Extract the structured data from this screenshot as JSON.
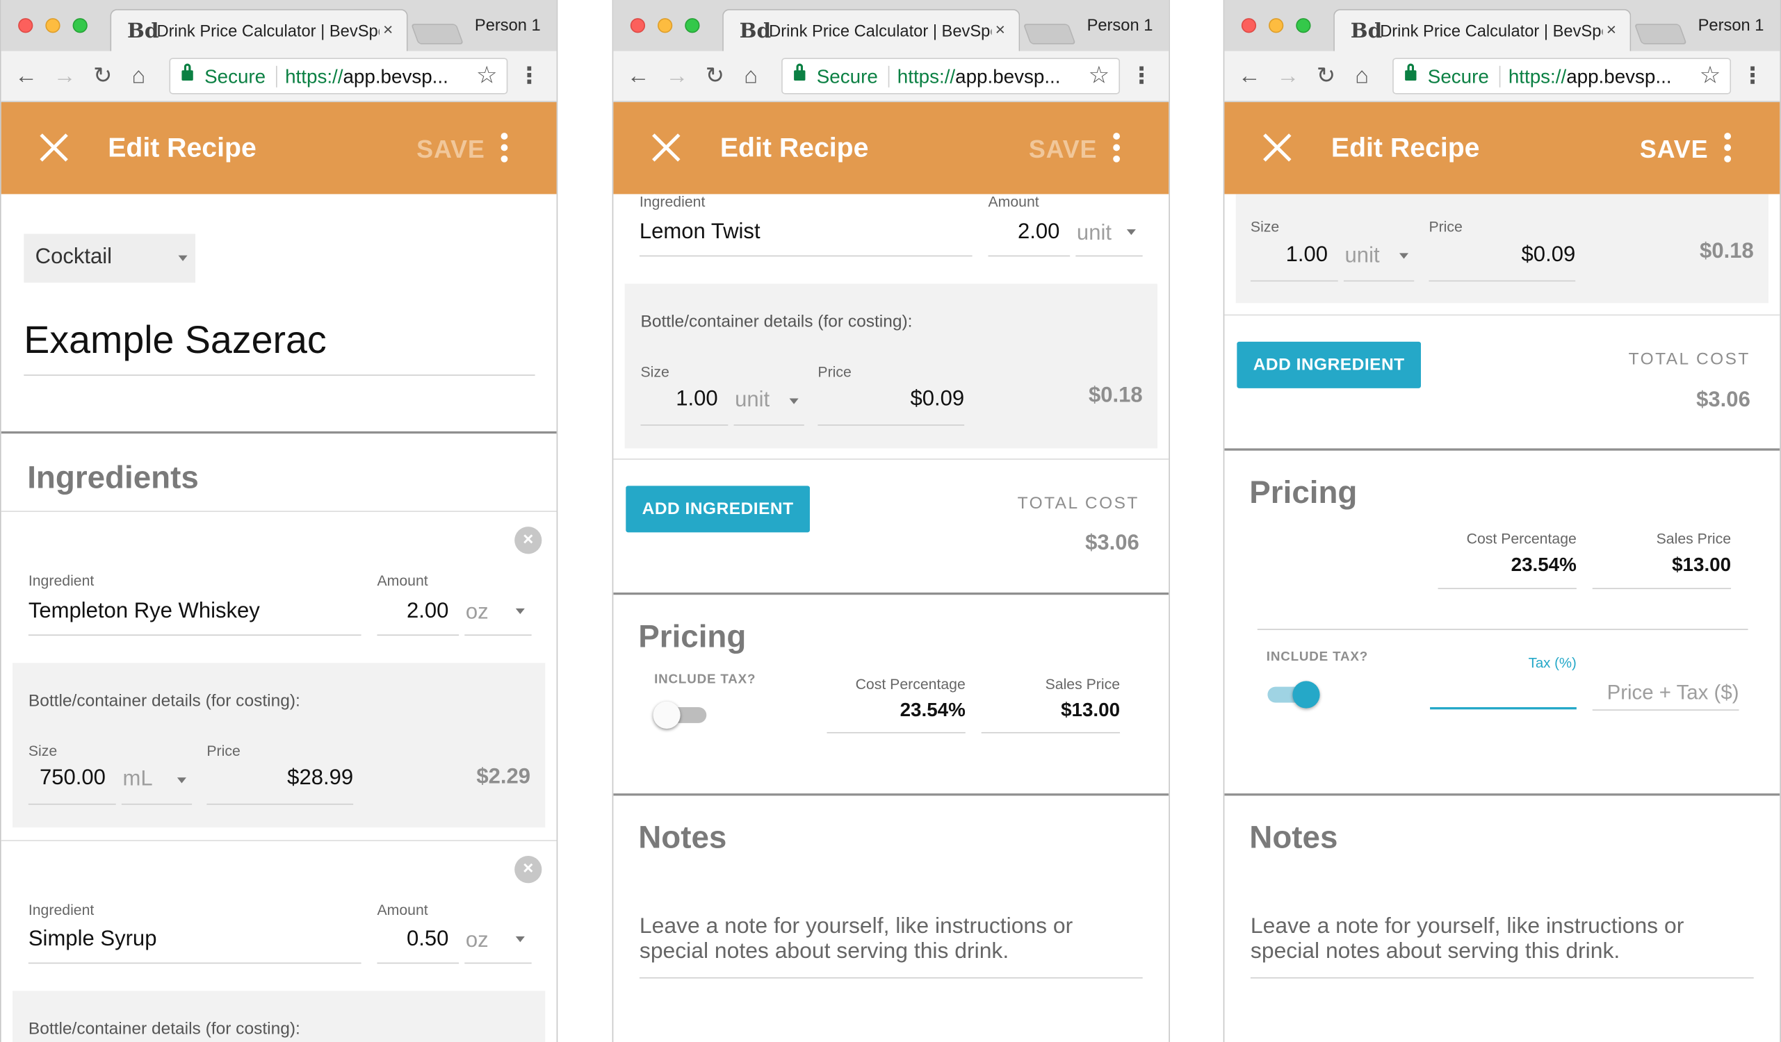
{
  "browser": {
    "tab_logo": "Bd",
    "tab_title": "Drink Price Calculator | BevSpot",
    "tab_close": "×",
    "person": "Person 1",
    "secure_label": "Secure",
    "url_protocol": "https://",
    "url_rest": "app.bevsp...",
    "icons": [
      "back-arrow-icon",
      "forward-arrow-icon",
      "reload-icon",
      "home-icon",
      "lock-icon",
      "star-icon",
      "menu-icon"
    ]
  },
  "appbar": {
    "title": "Edit Recipe",
    "save_label": "SAVE",
    "color": "#e39a4e"
  },
  "screen1": {
    "category": "Cocktail",
    "recipe_name": "Example Sazerac",
    "ingredients_title": "Ingredients",
    "ingredients": [
      {
        "ingredient_label": "Ingredient",
        "name": "Templeton Rye Whiskey",
        "amount_label": "Amount",
        "amount": "2.00",
        "unit": "oz",
        "box_title": "Bottle/container details (for costing):",
        "size_label": "Size",
        "size": "750.00",
        "size_unit": "mL",
        "price_label": "Price",
        "price": "$28.99",
        "line_cost": "$2.29"
      },
      {
        "ingredient_label": "Ingredient",
        "name": "Simple Syrup",
        "amount_label": "Amount",
        "amount": "0.50",
        "unit": "oz",
        "box_title": "Bottle/container details (for costing):"
      }
    ]
  },
  "screen2": {
    "ingredient": {
      "ingredient_label": "Ingredient",
      "name": "Lemon Twist",
      "amount_label": "Amount",
      "amount": "2.00",
      "unit": "unit",
      "box_title": "Bottle/container details (for costing):",
      "size_label": "Size",
      "size": "1.00",
      "size_unit": "unit",
      "price_label": "Price",
      "price": "$0.09",
      "line_cost": "$0.18"
    },
    "add_ingredient": "ADD INGREDIENT",
    "total_cost_label": "TOTAL COST",
    "total_cost": "$3.06",
    "pricing_title": "Pricing",
    "include_tax_label": "INCLUDE TAX?",
    "include_tax": false,
    "cost_pct_label": "Cost Percentage",
    "cost_pct": "23.54%",
    "sales_price_label": "Sales Price",
    "sales_price": "$13.00",
    "notes_title": "Notes",
    "notes_placeholder": "Leave a note for yourself, like instructions or special notes about serving this drink."
  },
  "screen3": {
    "size_label": "Size",
    "size": "1.00",
    "size_unit": "unit",
    "price_label": "Price",
    "price": "$0.09",
    "line_cost": "$0.18",
    "add_ingredient": "ADD INGREDIENT",
    "total_cost_label": "TOTAL COST",
    "total_cost": "$3.06",
    "pricing_title": "Pricing",
    "cost_pct_label": "Cost Percentage",
    "cost_pct": "23.54%",
    "sales_price_label": "Sales Price",
    "sales_price": "$13.00",
    "include_tax_label": "INCLUDE TAX?",
    "include_tax": true,
    "tax_label": "Tax (%)",
    "price_tax_placeholder": "Price + Tax ($)",
    "notes_title": "Notes",
    "notes_placeholder": "Leave a note for yourself, like instructions or special notes about serving this drink."
  }
}
